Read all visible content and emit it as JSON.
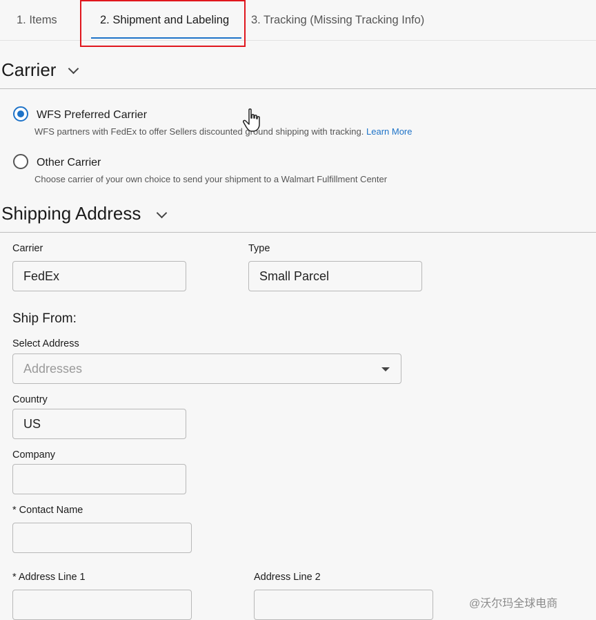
{
  "tabs": [
    {
      "label": "1. Items"
    },
    {
      "label": "2. Shipment and Labeling"
    },
    {
      "label": "3. Tracking (Missing Tracking Info)"
    }
  ],
  "carrier_section": {
    "title": "Carrier",
    "options": [
      {
        "label": "WFS Preferred Carrier",
        "description": "WFS partners with FedEx to offer Sellers discounted ground shipping with tracking.",
        "link": "Learn More",
        "selected": true
      },
      {
        "label": "Other Carrier",
        "description": "Choose carrier of your own choice to send your shipment to a Walmart Fulfillment Center",
        "selected": false
      }
    ]
  },
  "shipping_section": {
    "title": "Shipping Address",
    "carrier": {
      "label": "Carrier",
      "value": "FedEx"
    },
    "type": {
      "label": "Type",
      "value": "Small Parcel"
    },
    "ship_from": "Ship From:",
    "select_address": {
      "label": "Select Address",
      "placeholder": "Addresses"
    },
    "country": {
      "label": "Country",
      "value": "US"
    },
    "company": {
      "label": "Company",
      "value": ""
    },
    "contact_name": {
      "label": "* Contact Name",
      "value": ""
    },
    "address_line1": {
      "label": "* Address Line 1",
      "value": ""
    },
    "address_line2": {
      "label": "Address Line 2",
      "value": ""
    }
  },
  "watermark": "@沃尔玛全球电商",
  "colors": {
    "accent": "#1e73c8",
    "highlight": "#e0161d"
  },
  "icons": {
    "chevron": "chevron-down-icon",
    "caret": "caret-down-icon",
    "cursor": "hand-pointer-icon"
  }
}
